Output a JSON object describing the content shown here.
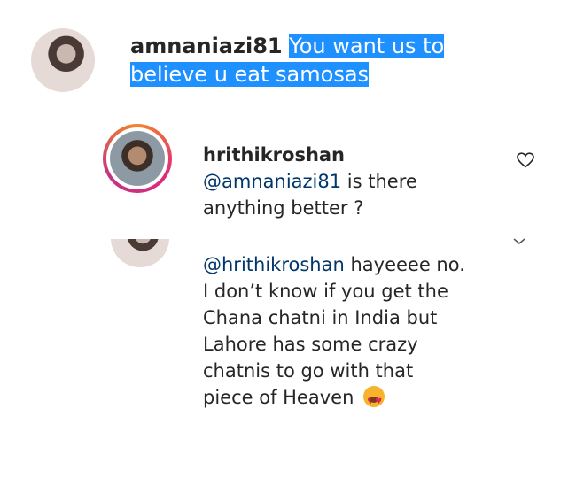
{
  "main_comment": {
    "username": "amnaniazi81",
    "text": "You want us to believe u eat samosas"
  },
  "reply_1": {
    "username": "hrithikroshan",
    "mention": "@amnaniazi81",
    "text": "is there anything better ?"
  },
  "reply_2": {
    "mention": "@hrithikroshan",
    "text": "hayeeee no. I don’t know if you get the Chana chatni in India but Lahore has some crazy chatnis to go with that piece of Heaven"
  },
  "icons": {
    "like": "heart-outline-icon",
    "expand": "chevron-down-icon",
    "emoji": "heart-eyes-emoji-icon"
  },
  "colors": {
    "highlight": "#1e90ff",
    "mention": "#00376b",
    "text": "#262626"
  }
}
